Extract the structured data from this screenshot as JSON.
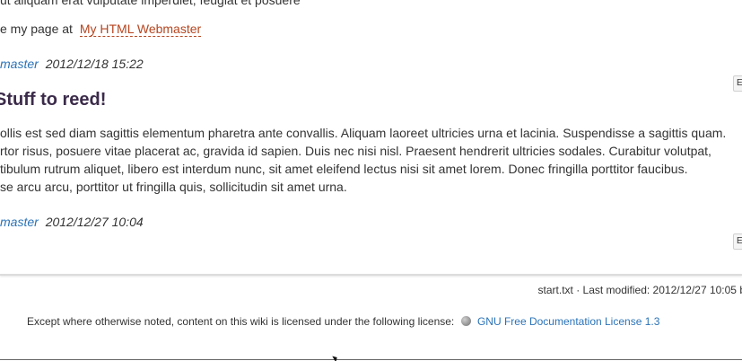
{
  "top_clip_text": "ut aliquam erat vulputate imperdiet, feugiat et posuere",
  "see_line": {
    "prefix": "e my page at",
    "link": "My HTML Webmaster"
  },
  "posts": [
    {
      "author": "master",
      "date": "2012/12/18 15:22",
      "title": "Stuff to reed!",
      "body_lines": [
        "ollis est sed diam sagittis elementum pharetra ante convallis. Aliquam laoreet ultricies urna et lacinia. Suspendisse a sagittis quam.",
        "rtor risus, posuere vitae placerat ac, gravida id sapien. Duis nec nisi nisl. Praesent hendrerit ultricies sodales. Curabitur volutpat,",
        "tibulum rutrum aliquet, libero est interdum nunc, sit amet eleifend lectus nisi sit amet lorem. Donec fringilla porttitor faucibus.",
        "se arcu arcu, porttitor ut fringilla quis, sollicitudin sit amet urna."
      ],
      "edit_label": "E"
    },
    {
      "author": "master",
      "date": "2012/12/27 10:04",
      "edit_label": "E"
    }
  ],
  "doc_info": "start.txt · Last modified: 2012/12/27 10:05 b",
  "license": {
    "text": "Except where otherwise noted, content on this wiki is licensed under the following license:",
    "icon": "globe-icon",
    "link": "GNU Free Documentation License 1.3"
  }
}
